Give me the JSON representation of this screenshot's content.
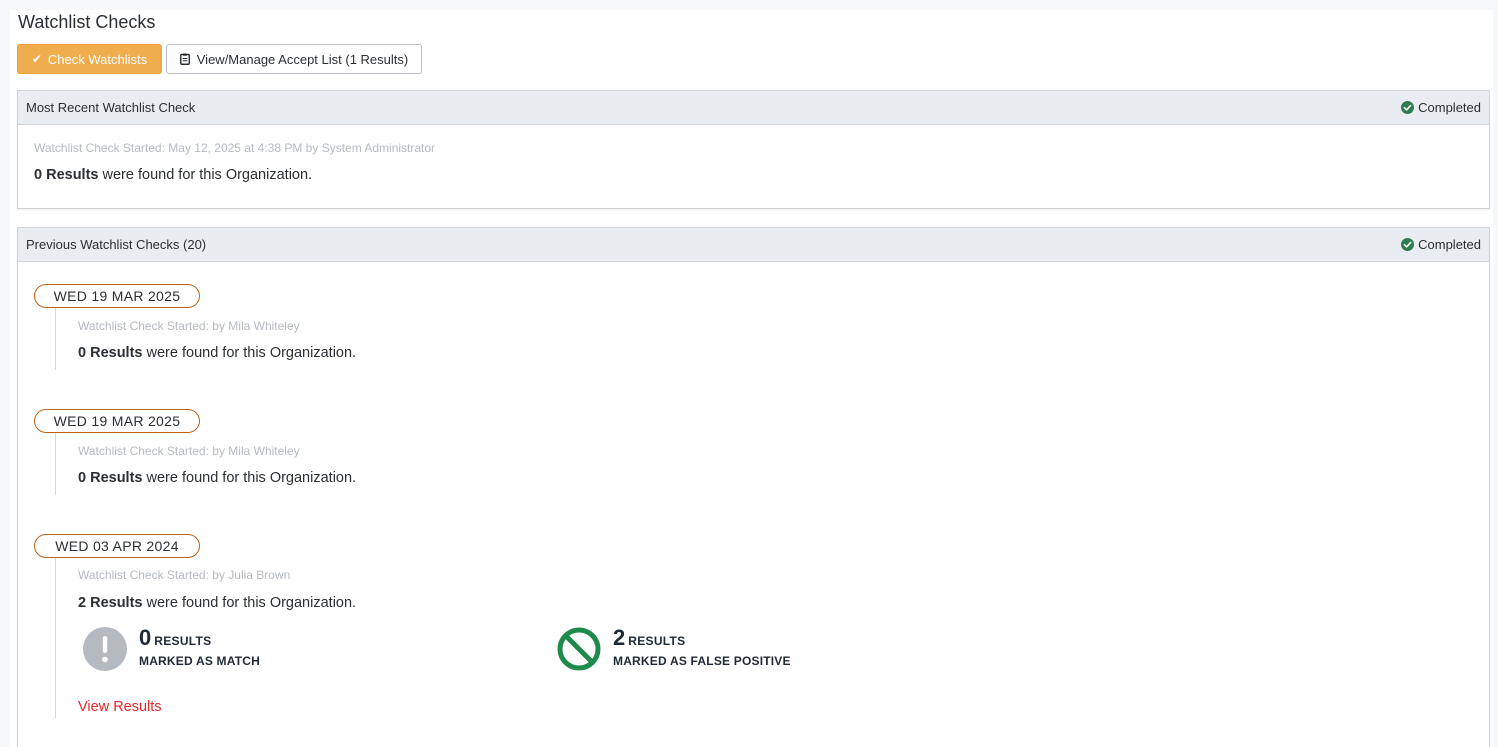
{
  "page": {
    "title": "Watchlist Checks"
  },
  "toolbar": {
    "check_button": "Check Watchlists",
    "manage_button": "View/Manage Accept List (1 Results)"
  },
  "recent": {
    "heading": "Most Recent Watchlist Check",
    "status": "Completed",
    "started": "Watchlist Check Started: May 12, 2025 at 4:38 PM by System Administrator",
    "count": "0 Results",
    "suffix": " were found for this Organization."
  },
  "previous": {
    "heading": "Previous Watchlist Checks (20)",
    "status": "Completed",
    "entries": [
      {
        "date": "WED 19 MAR 2025",
        "started": "Watchlist Check Started: by Mila Whiteley",
        "count": "0 Results",
        "suffix": " were found for this Organization."
      },
      {
        "date": "WED 19 MAR 2025",
        "started": "Watchlist Check Started: by Mila Whiteley",
        "count": "0 Results",
        "suffix": " were found for this Organization."
      },
      {
        "date": "WED 03 APR 2024",
        "started": "Watchlist Check Started: by Julia Brown",
        "count": "2 Results",
        "suffix": " were found for this Organization.",
        "match": {
          "num": "0",
          "unit": "RESULTS",
          "label": "MARKED AS MATCH"
        },
        "false_positive": {
          "num": "2",
          "unit": "RESULTS",
          "label": "MARKED AS FALSE POSITIVE"
        },
        "link": "View Results"
      }
    ]
  },
  "colors": {
    "accent": "#f0ad4e",
    "completed": "#2e7d4f",
    "pill_border": "#c0601a",
    "link": "#e8262b",
    "match_icon": "#b5bac0",
    "false_positive_icon": "#1e8a4c"
  },
  "icons": {
    "check_button": "check-icon",
    "manage_button": "clipboard-icon",
    "status": "check-circle-icon",
    "match": "exclamation-circle-icon",
    "false_positive": "ban-icon"
  }
}
